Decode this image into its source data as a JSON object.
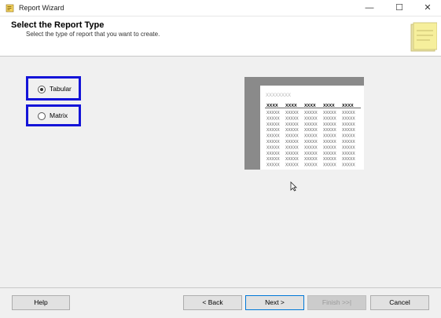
{
  "window": {
    "title": "Report Wizard",
    "minimize_glyph": "—",
    "maximize_glyph": "☐",
    "close_glyph": "✕"
  },
  "header": {
    "title": "Select the Report Type",
    "subtitle": "Select the type of report that you want to create."
  },
  "report_types": [
    {
      "label": "Tabular",
      "selected": true
    },
    {
      "label": "Matrix",
      "selected": false
    }
  ],
  "preview": {
    "title_placeholder": "XXXXXXXX",
    "column_headers": [
      "XXXX",
      "XXXX",
      "XXXX",
      "XXXX",
      "XXXX"
    ],
    "cell_placeholder": "XXXXX",
    "row_count": 10
  },
  "buttons": {
    "help": "Help",
    "back": "< Back",
    "next": "Next >",
    "finish": "Finish >>|",
    "cancel": "Cancel"
  },
  "colors": {
    "highlight_border": "#1414d8",
    "next_border": "#0078d7"
  }
}
